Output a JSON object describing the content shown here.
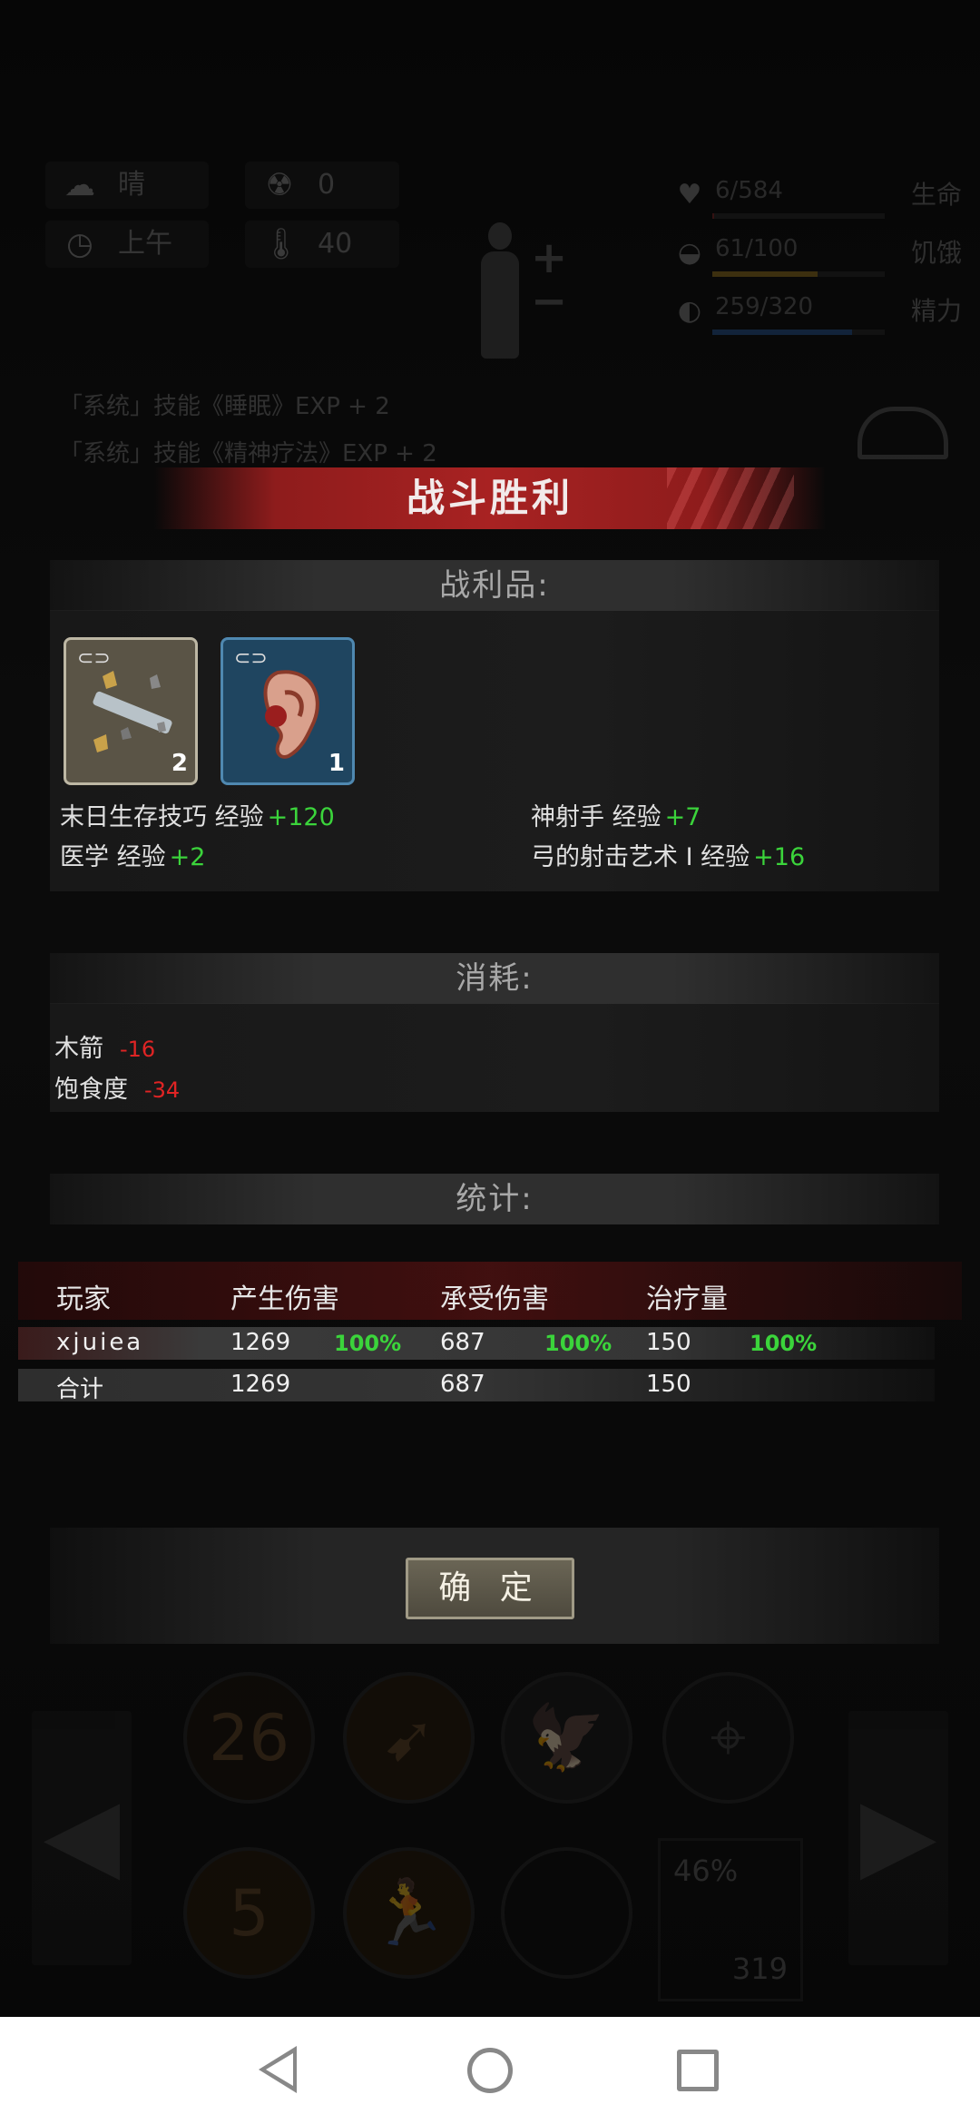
{
  "hud": {
    "weather": "晴",
    "radiation": "0",
    "time_of_day": "上午",
    "temperature": "40",
    "stats": [
      {
        "value": "6/584",
        "label": "生命",
        "fill": 0.01,
        "color": "#8a2a2a"
      },
      {
        "value": "61/100",
        "label": "饥饿",
        "fill": 0.61,
        "color": "#a07a20"
      },
      {
        "value": "259/320",
        "label": "精力",
        "fill": 0.81,
        "color": "#2a5a9a"
      }
    ]
  },
  "log": {
    "line1": "「系统」技能《睡眠》EXP + 2",
    "line2": "「系统」技能《精神疗法》EXP + 2"
  },
  "dialog": {
    "title": "战斗胜利",
    "loot_header": "战利品:",
    "loot_items": [
      {
        "name": "scrap",
        "qty": "2"
      },
      {
        "name": "ear",
        "qty": "1"
      }
    ],
    "exp_gains": [
      {
        "skill": "末日生存技巧 经验",
        "gain": "+120"
      },
      {
        "skill": "神射手 经验",
        "gain": "+7"
      },
      {
        "skill": "医学 经验",
        "gain": "+2"
      },
      {
        "skill": "弓的射击艺术 I  经验",
        "gain": "+16"
      }
    ],
    "consume_header": "消耗:",
    "consumption": [
      {
        "name": "木箭",
        "amount": "-16"
      },
      {
        "name": "饱食度",
        "amount": "-34"
      }
    ],
    "stats_header": "统计:",
    "stats_table": {
      "headers": [
        "玩家",
        "产生伤害",
        "承受伤害",
        "治疗量"
      ],
      "rows": [
        {
          "player": "xjuiea",
          "dealt": "1269",
          "dealt_pct": "100%",
          "taken": "687",
          "taken_pct": "100%",
          "heal": "150",
          "heal_pct": "100%"
        },
        {
          "player": "合计",
          "dealt": "1269",
          "taken": "687",
          "heal": "150"
        }
      ]
    },
    "confirm_label": "确 定"
  },
  "skillbar": {
    "skill1_value": "26",
    "skill5_value": "5",
    "percent": "46%",
    "count": "319"
  },
  "colors": {
    "banner_red": "#a82222",
    "gain_green": "#3bd43b",
    "loss_red": "#e02424"
  }
}
